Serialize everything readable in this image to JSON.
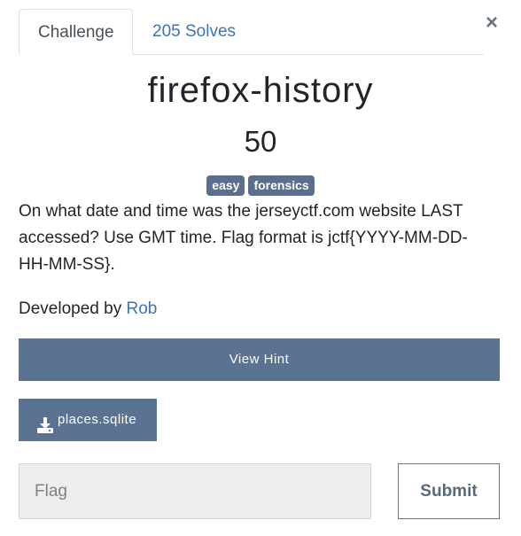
{
  "tabs": {
    "challenge": "Challenge",
    "solves": "205 Solves"
  },
  "close_symbol": "×",
  "challenge": {
    "name": "firefox-history",
    "points": "50",
    "tags": [
      "easy",
      "forensics"
    ],
    "description": "On what date and time was the jerseyctf.com website LAST accessed? Use GMT time. Flag format is jctf{YYYY-MM-DD-HH-MM-SS}.",
    "developed_by_prefix": "Developed by",
    "author": "Rob"
  },
  "hint_button": "View Hint",
  "file_button": {
    "label": "places.sqlite",
    "icon": "download-icon"
  },
  "flag_input": {
    "placeholder": "Flag",
    "value": ""
  },
  "submit_button": "Submit",
  "colors": {
    "accent_button": "#5b7392",
    "tag_background": "#5b6f8c",
    "link": "#3b73b9"
  }
}
